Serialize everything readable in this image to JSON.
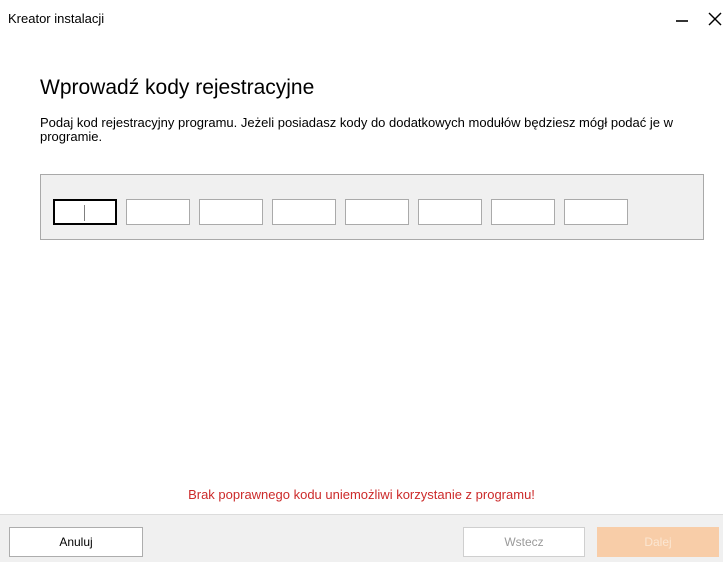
{
  "window": {
    "title": "Kreator instalacji"
  },
  "page": {
    "heading": "Wprowadź kody rejestracyjne",
    "description": "Podaj kod rejestracyjny programu. Jeżeli posiadasz kody do dodatkowych modułów będziesz mógł podać je w programie."
  },
  "code_fields": [
    "",
    "",
    "",
    "",
    "",
    "",
    "",
    ""
  ],
  "warning": "Brak poprawnego kodu uniemożliwi korzystanie z programu!",
  "footer": {
    "cancel_label": "Anuluj",
    "back_label": "Wstecz",
    "next_label": "Dalej"
  },
  "colors": {
    "warning": "#cc2a2a",
    "accent_disabled": "#f8cda8",
    "panel": "#f0f0f0"
  },
  "icons": {
    "minimize": "minimize-icon",
    "close": "close-icon"
  }
}
